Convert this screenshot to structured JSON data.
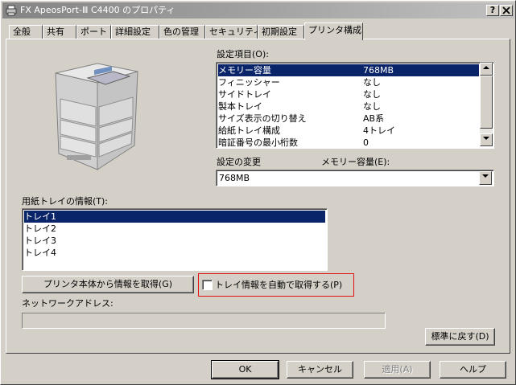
{
  "window": {
    "title": "FX ApeosPort-Ⅲ C4400 のプロパティ",
    "help_button": "?",
    "close_button": "X"
  },
  "tabs": [
    {
      "label": "全般"
    },
    {
      "label": "共有"
    },
    {
      "label": "ポート"
    },
    {
      "label": "詳細設定"
    },
    {
      "label": "色の管理"
    },
    {
      "label": "セキュリティ"
    },
    {
      "label": "初期設定"
    },
    {
      "label": "プリンタ構成",
      "active": true
    }
  ],
  "settings": {
    "label": "設定項目(O):",
    "items": [
      {
        "name": "メモリー容量",
        "value": "768MB",
        "selected": true
      },
      {
        "name": "フィニッシャー",
        "value": "なし"
      },
      {
        "name": "サイドトレイ",
        "value": "なし"
      },
      {
        "name": "製本トレイ",
        "value": "なし"
      },
      {
        "name": "サイズ表示の切り替え",
        "value": "AB系"
      },
      {
        "name": "給紙トレイ構成",
        "value": "4トレイ"
      },
      {
        "name": "暗証番号の最小桁数",
        "value": "0"
      }
    ]
  },
  "change": {
    "label": "設定の変更",
    "target_label": "メモリー容量(E):",
    "selected_value": "768MB"
  },
  "trays": {
    "label": "用紙トレイの情報(T):",
    "items": [
      {
        "name": "トレイ1",
        "selected": true
      },
      {
        "name": "トレイ2"
      },
      {
        "name": "トレイ3"
      },
      {
        "name": "トレイ4"
      }
    ]
  },
  "get_info_button": "プリンタ本体から情報を取得(G)",
  "auto_get_checkbox": {
    "label": "トレイ情報を自動で取得する(P)",
    "checked": false
  },
  "network_address": {
    "label": "ネットワークアドレス:",
    "value": ""
  },
  "restore_defaults_button": "標準に戻す(D)",
  "footer": {
    "ok": "OK",
    "cancel": "キャンセル",
    "apply": "適用(A)",
    "help": "ヘルプ"
  },
  "colors": {
    "selection": "#0a246a",
    "highlight_box": "#e01010",
    "face": "#d4d0c8"
  }
}
